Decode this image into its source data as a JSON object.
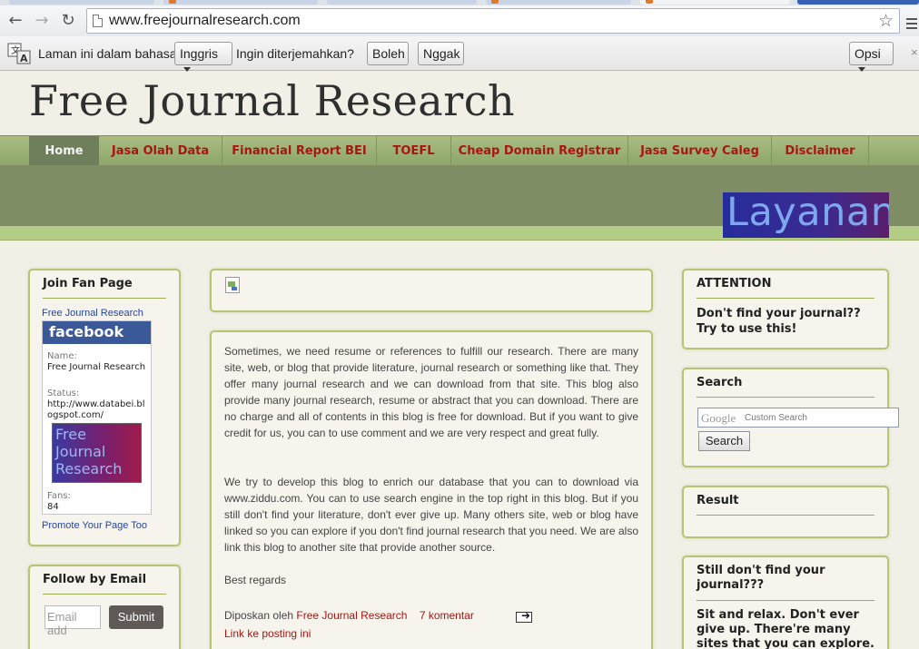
{
  "browser": {
    "url": "www.freejournalresearch.com",
    "translate": {
      "prefix": "Laman ini dalam bahasa",
      "language": "Inggris",
      "question": "Ingin diterjemahkan?",
      "yes": "Boleh",
      "no": "Nggak",
      "options": "Opsi"
    }
  },
  "blog": {
    "title": "Free Journal Research",
    "nav": [
      "Home",
      "Jasa Olah Data",
      "Financial Report BEI",
      "TOEFL",
      "Cheap Domain Registrar",
      "Jasa Survey Caleg",
      "Disclaimer"
    ],
    "banner_text": "Layanan"
  },
  "left": {
    "fan_title": "Join Fan Page",
    "fan_link": "Free Journal Research",
    "fb_brand": "facebook",
    "fb_name_label": "Name:",
    "fb_name": "Free Journal Research",
    "fb_status_label": "Status:",
    "fb_status": "http://www.databei.blogspot.com/",
    "fb_avatar_text": "Free Journal Research",
    "fb_fans_label": "Fans:",
    "fb_fans": "84",
    "promote": "Promote Your Page Too",
    "follow_title": "Follow by Email",
    "email_placeholder": "Email add",
    "submit": "Submit"
  },
  "post": {
    "p1": "Sometimes, we need resume or references to fulfill our research. There are many site, web, or blog that provide literature, journal research or something like that. They offer many journal research and we can download from that site. This blog also provide many journal research, resume or abstract that you can download. There are no charge and all of contents in this blog is free for download. But if you want to give credit for us, you can to use comment and we are very respect and great fully.",
    "p2": "We try to develop this blog to enrich our database that you can to download via www.ziddu.com. You can to use search engine in the top right in this blog. But if you still don't find your literature, don't ever give up. Many others site, web or blog have linked so you can explore if you don't find journal research that you need. We are also link this blog to another site that provide another source.",
    "regards": "Best regards",
    "posted_by": "Diposkan oleh",
    "author": "Free Journal Research",
    "comments": "7 komentar",
    "permalink": "Link ke posting ini"
  },
  "right": {
    "attention_title": "ATTENTION",
    "attention_text": "Don't find your journal?? Try to use this!",
    "search_title": "Search",
    "search_google": "Google",
    "search_custom": "Custom Search",
    "search_button": "Search",
    "result_title": "Result",
    "still_title": "Still don't find your journal???",
    "still_text": "Sit and relax. Don't ever give up. There're many sites that you can explore."
  }
}
